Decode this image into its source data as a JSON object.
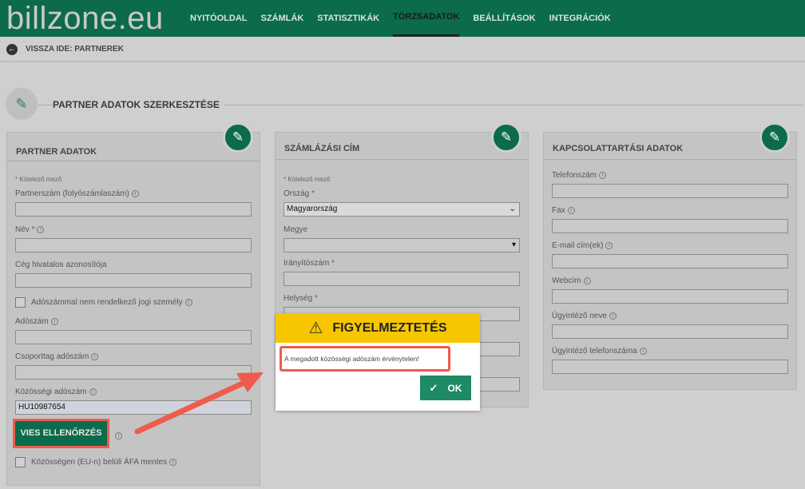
{
  "app": {
    "logo": "billzone.eu"
  },
  "nav": [
    {
      "label": "NYITÓOLDAL"
    },
    {
      "label": "SZÁMLÁK"
    },
    {
      "label": "STATISZTIKÁK"
    },
    {
      "label": "TÖRZSADATOK",
      "active": true
    },
    {
      "label": "BEÁLLÍTÁSOK"
    },
    {
      "label": "INTEGRÁCIÓK"
    }
  ],
  "back": {
    "label": "VISSZA IDE: PARTNEREK"
  },
  "section": {
    "title": "PARTNER ADATOK SZERKESZTÉSE"
  },
  "partner": {
    "title": "PARTNER ADATOK",
    "required_note": "* Kötelező mező",
    "partnerszam_label": "Partnerszám (folyószámlaszám)",
    "partnerszam_value": "",
    "nev_label": "Név",
    "nev_value": "",
    "ceg_label": "Cég hivatalos azonosítója",
    "ceg_value": "",
    "no_tax_label": "Adószámmal nem rendelkező jogi személy",
    "adoszam_label": "Adószám",
    "adoszam_value": "",
    "csoport_label": "Csoporttag adószám",
    "csoport_value": "",
    "kozossegi_label": "Közösségi adószám",
    "kozossegi_value": "HU10987654",
    "vies_button": "VIES ELLENŐRZÉS",
    "eu_afa_label": "Közösségen (EU-n) belüli ÁFA mentes"
  },
  "billing": {
    "title": "SZÁMLÁZÁSI CÍM",
    "required_note": "* Kötelező mező",
    "orszag_label": "Ország",
    "orszag_value": "Magyarország",
    "megye_label": "Megye",
    "megye_value": "",
    "irsz_label": "Irányítószám",
    "irsz_value": "",
    "helyseg_label": "Helység",
    "helyseg_value": ""
  },
  "contact": {
    "title": "KAPCSOLATTARTÁSI ADATOK",
    "telefon_label": "Telefonszám",
    "fax_label": "Fax",
    "email_label": "E-mail cím(ek)",
    "web_label": "Webcím",
    "ugyintezo_label": "Ügyintéző neve",
    "ugyintezo_tel_label": "Ügyintéző telefonszáma"
  },
  "modal": {
    "title": "FIGYELMEZTETÉS",
    "message": "A megadott közösségi adószám érvénytelen!",
    "ok_label": "OK"
  },
  "colors": {
    "brand": "#0b6b4b",
    "warning": "#f7c600",
    "highlight": "#ef5b4c"
  }
}
